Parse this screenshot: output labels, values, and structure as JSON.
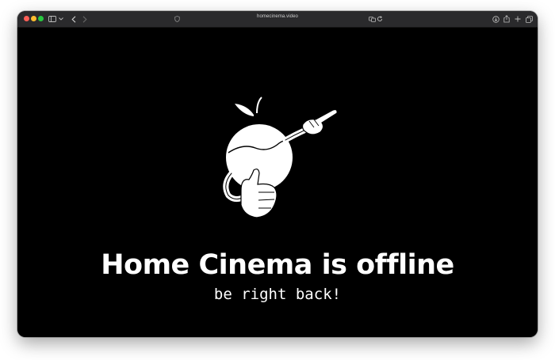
{
  "browser": {
    "url": "homecinema.video",
    "icons": {
      "sidebar": "sidebar-icon",
      "chevron": "chevron-down-icon",
      "back": "back-arrow-icon",
      "forward": "forward-arrow-icon",
      "privacy": "shield-icon",
      "translate": "translate-icon",
      "reload": "reload-icon",
      "download": "download-icon",
      "share": "share-icon",
      "new_tab": "plus-icon",
      "tabs": "tab-overview-icon"
    }
  },
  "page": {
    "title": "Home Cinema is offline",
    "subtitle": "be right back!",
    "mascot": "peach-mascot-pointing-thumbs-up"
  }
}
